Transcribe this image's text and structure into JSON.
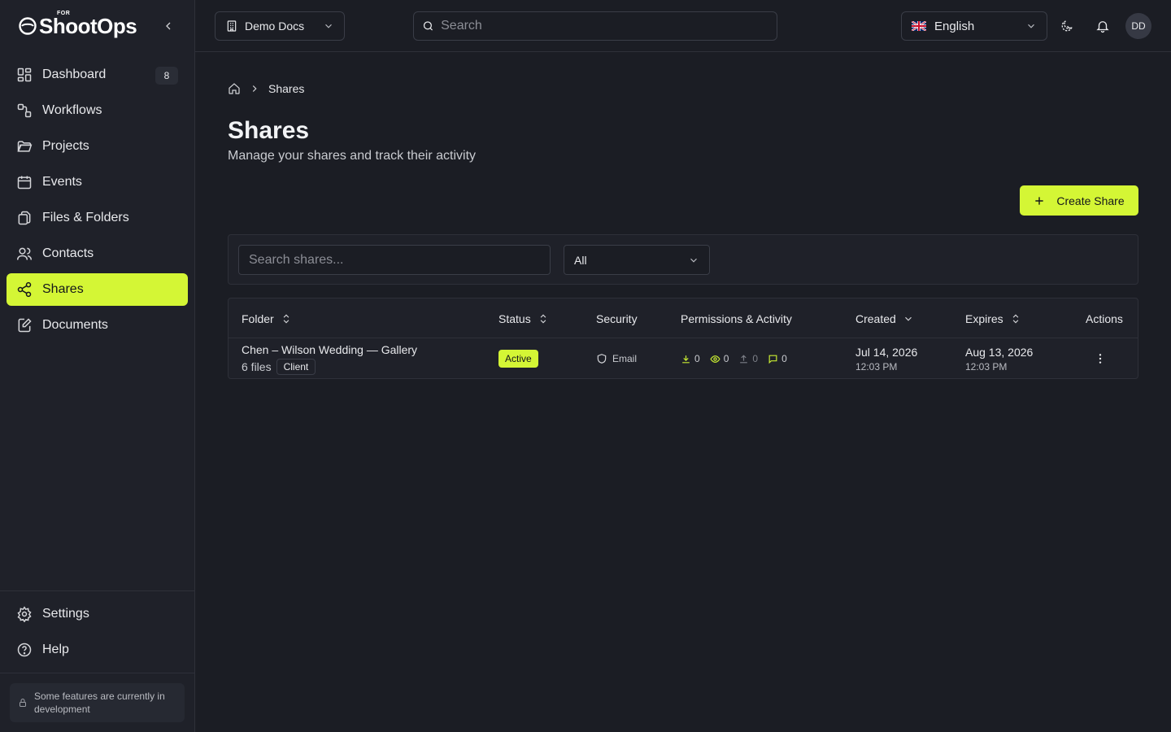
{
  "brand": {
    "logo_text": "ShootOps",
    "logo_prefix": "FOR",
    "accent": "#d4f635"
  },
  "sidebar": {
    "items": [
      {
        "label": "Dashboard",
        "icon": "dashboard-icon",
        "badge": "8"
      },
      {
        "label": "Workflows",
        "icon": "workflow-icon"
      },
      {
        "label": "Projects",
        "icon": "folder-icon"
      },
      {
        "label": "Events",
        "icon": "calendar-icon"
      },
      {
        "label": "Files & Folders",
        "icon": "files-icon"
      },
      {
        "label": "Contacts",
        "icon": "users-icon"
      },
      {
        "label": "Shares",
        "icon": "share-icon",
        "active": true
      },
      {
        "label": "Documents",
        "icon": "document-edit-icon"
      }
    ],
    "bottom_items": [
      {
        "label": "Settings",
        "icon": "gear-icon"
      },
      {
        "label": "Help",
        "icon": "help-icon"
      }
    ],
    "dev_note": "Some features are currently in development"
  },
  "topbar": {
    "workspace": "Demo Docs",
    "search_placeholder": "Search",
    "language": "English",
    "avatar_initials": "DD"
  },
  "breadcrumb": {
    "current": "Shares"
  },
  "page": {
    "title": "Shares",
    "subtitle": "Manage your shares and track their activity",
    "create_button": "Create Share"
  },
  "filters": {
    "search_placeholder": "Search shares...",
    "status_selected": "All"
  },
  "table": {
    "columns": {
      "folder": "Folder",
      "status": "Status",
      "security": "Security",
      "permissions": "Permissions & Activity",
      "created": "Created",
      "expires": "Expires",
      "actions": "Actions"
    },
    "rows": [
      {
        "folder": "Chen – Wilson Wedding — Gallery",
        "files": "6 files",
        "audience": "Client",
        "status": "Active",
        "security": "Email",
        "downloads": "0",
        "views": "0",
        "uploads": "0",
        "comments": "0",
        "created_date": "Jul 14, 2026",
        "created_time": "12:03 PM",
        "expires_date": "Aug 13, 2026",
        "expires_time": "12:03 PM"
      }
    ]
  }
}
